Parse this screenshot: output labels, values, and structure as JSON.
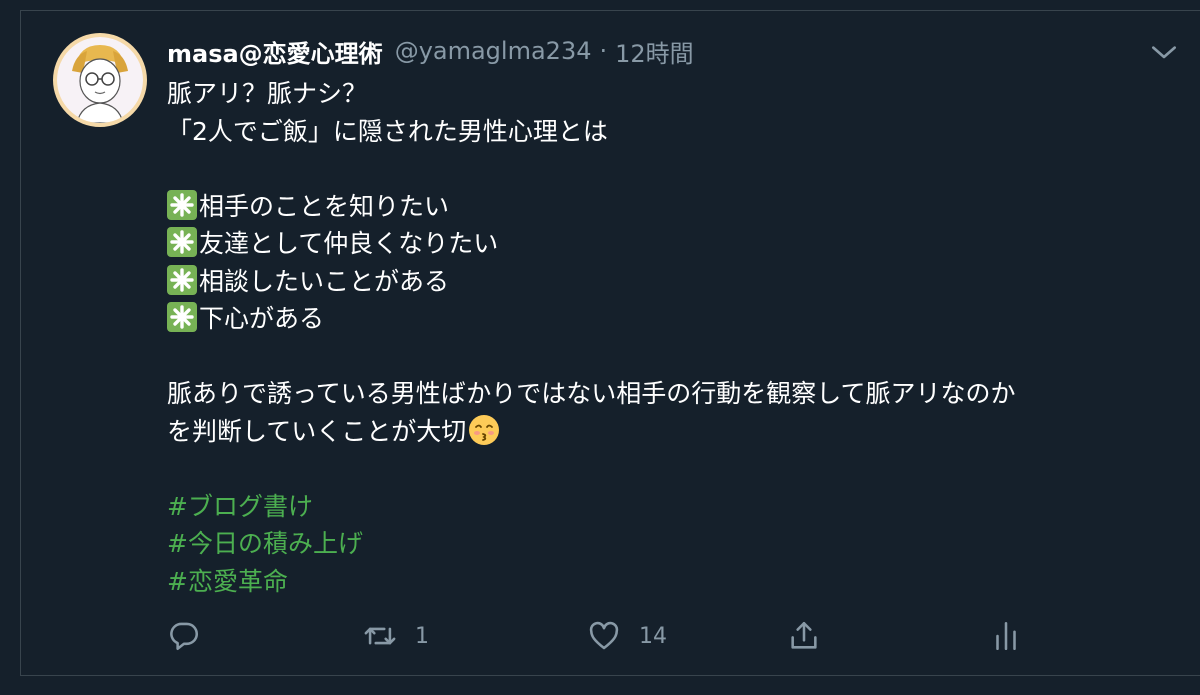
{
  "tweet": {
    "display_name": "masa@恋愛心理術",
    "handle": "@yamaglma234",
    "separator": "·",
    "time": "12時間",
    "lines": [
      "脈アリ？脈ナシ？",
      "「2人でご飯」に隠された男性心理とは"
    ],
    "list_items": [
      "相手のことを知りたい",
      "友達として仲良くなりたい",
      "相談したいことがある",
      "下心がある"
    ],
    "paragraph_line1": "脈ありで誘っている男性ばかりではない相手の行動を観察して脈アリなのか",
    "paragraph_line2": "を判断していくことが大切",
    "hashtags": [
      "#ブログ書け",
      "#今日の積み上げ",
      "#恋愛革命"
    ],
    "counts": {
      "reply": "",
      "retweet": "1",
      "like": "14"
    }
  },
  "icons": {
    "more": "chevron-down-icon",
    "list_bullet": "eight-spoked-asterisk-icon",
    "emoji": "kissing-face-icon",
    "reply": "reply-icon",
    "retweet": "retweet-icon",
    "like": "heart-icon",
    "share": "share-icon",
    "analytics": "analytics-icon"
  },
  "colors": {
    "background": "#15202b",
    "secondary_text": "#8899a6",
    "hashtag": "#4caf50",
    "bullet": "#77b255"
  }
}
